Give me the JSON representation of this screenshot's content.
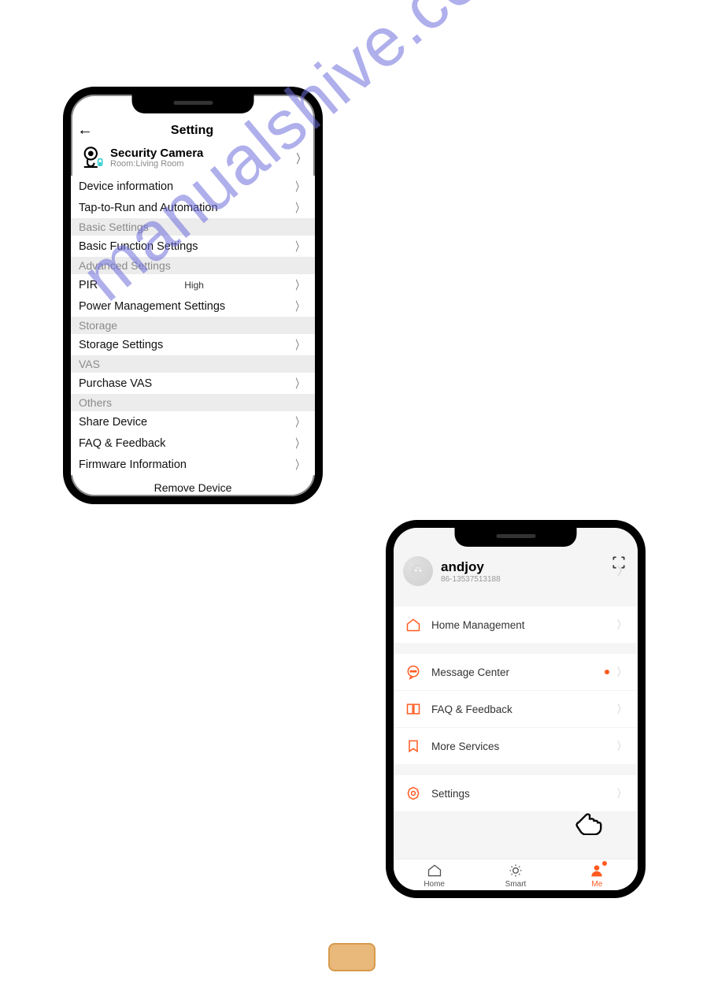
{
  "watermark": "manualshive.com",
  "phoneA": {
    "title": "Setting",
    "device": {
      "name": "Security Camera",
      "room": "Room:Living Room"
    },
    "rows": {
      "device_info": "Device information",
      "automation": "Tap-to-Run and Automation",
      "basic_func": "Basic Function Settings",
      "pir": "PIR",
      "pir_value": "High",
      "power_mgmt": "Power Management Settings",
      "storage_set": "Storage Settings",
      "purchase_vas": "Purchase VAS",
      "share": "Share Device",
      "faq": "FAQ & Feedback",
      "firmware": "Firmware Information"
    },
    "sections": {
      "basic": "Basic Settings",
      "advanced": "Advanced Settings",
      "storage": "Storage",
      "vas": "VAS",
      "others": "Others"
    },
    "remove": "Remove Device"
  },
  "phoneB": {
    "profile": {
      "name": "andjoy",
      "sub": "86-13537513188"
    },
    "menu": {
      "home_mgmt": "Home Management",
      "msg_center": "Message Center",
      "faq": "FAQ & Feedback",
      "more": "More Services",
      "settings": "Settings"
    },
    "tabs": {
      "home": "Home",
      "smart": "Smart",
      "me": "Me"
    }
  },
  "colors": {
    "accent": "#ff5a1f"
  }
}
